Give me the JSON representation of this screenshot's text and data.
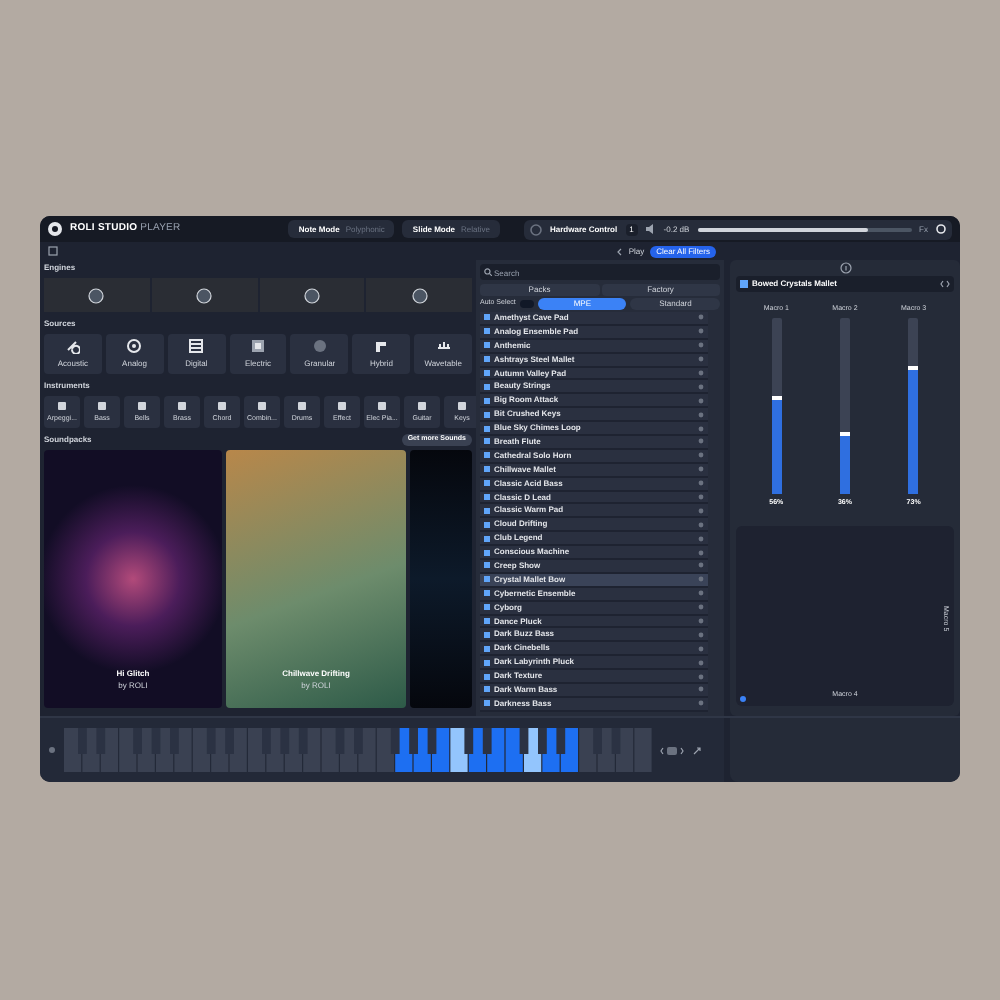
{
  "window": {
    "title_bold": "ROLI STUDIO",
    "title_light": "PLAYER"
  },
  "modes": [
    {
      "label": "Note Mode",
      "value": "Polyphonic"
    },
    {
      "label": "Slide Mode",
      "value": "Relative"
    }
  ],
  "hardware": {
    "label": "Hardware Control",
    "channel": "1",
    "volume": "-0.2 dB",
    "level": 0.8,
    "fx": "Fx"
  },
  "filters": {
    "play": "Play",
    "clear": "Clear All Filters"
  },
  "engines": {
    "title": "Engines"
  },
  "sources": {
    "title": "Sources",
    "items": [
      "Acoustic",
      "Analog",
      "Digital",
      "Electric",
      "Granular",
      "Hybrid",
      "Wavetable"
    ]
  },
  "instruments": {
    "title": "Instruments",
    "items": [
      "Arpeggi...",
      "Bass",
      "Bells",
      "Brass",
      "Chord",
      "Combin...",
      "Drums",
      "Effect",
      "Elec Pia...",
      "Guitar",
      "Keys"
    ]
  },
  "soundpacks": {
    "title": "Soundpacks",
    "more": "Get more Sounds",
    "cards": [
      {
        "name": "Hi Glitch",
        "by": "by ROLI",
        "kind": "neon"
      },
      {
        "name": "Chillwave Drifting",
        "by": "by ROLI",
        "kind": "pastel"
      },
      {
        "kind": "dark"
      }
    ]
  },
  "browser": {
    "search": {
      "placeholder": "Search"
    },
    "tabs": [
      {
        "label": "Packs",
        "selected": false
      },
      {
        "label": "Factory",
        "selected": false
      }
    ],
    "auto_select": {
      "label": "Auto Select",
      "on": false
    },
    "modes": [
      {
        "label": "MPE",
        "selected": true
      },
      {
        "label": "Standard",
        "selected": false
      }
    ],
    "presets": [
      {
        "name": "Amethyst Cave Pad",
        "selected": false
      },
      {
        "name": "Analog Ensemble Pad",
        "selected": false
      },
      {
        "name": "Anthemic",
        "selected": false
      },
      {
        "name": "Ashtrays Steel Mallet",
        "selected": false
      },
      {
        "name": "Autumn Valley Pad",
        "selected": false
      },
      {
        "name": "Beauty Strings",
        "selected": false
      },
      {
        "name": "Big Room Attack",
        "selected": false
      },
      {
        "name": "Bit Crushed Keys",
        "selected": false
      },
      {
        "name": "Blue Sky Chimes Loop",
        "selected": false
      },
      {
        "name": "Breath Flute",
        "selected": false
      },
      {
        "name": "Cathedral Solo Horn",
        "selected": false
      },
      {
        "name": "Chillwave Mallet",
        "selected": false
      },
      {
        "name": "Classic Acid Bass",
        "selected": false
      },
      {
        "name": "Classic D Lead",
        "selected": false
      },
      {
        "name": "Classic Warm Pad",
        "selected": false
      },
      {
        "name": "Cloud Drifting",
        "selected": false
      },
      {
        "name": "Club Legend",
        "selected": false
      },
      {
        "name": "Conscious Machine",
        "selected": false
      },
      {
        "name": "Creep Show",
        "selected": false
      },
      {
        "name": "Crystal Mallet Bow",
        "selected": true
      },
      {
        "name": "Cybernetic Ensemble",
        "selected": false
      },
      {
        "name": "Cyborg",
        "selected": false
      },
      {
        "name": "Dance Pluck",
        "selected": false
      },
      {
        "name": "Dark Buzz Bass",
        "selected": false
      },
      {
        "name": "Dark Cinebells",
        "selected": false
      },
      {
        "name": "Dark Labyrinth Pluck",
        "selected": false
      },
      {
        "name": "Dark Texture",
        "selected": false
      },
      {
        "name": "Dark Warm Bass",
        "selected": false
      },
      {
        "name": "Darkness Bass",
        "selected": false
      }
    ]
  },
  "macros": {
    "preset": "Bowed Crystals Mallet",
    "sliders": [
      {
        "label": "Macro 1",
        "level": 0.56,
        "reading": "56%"
      },
      {
        "label": "Macro 2",
        "level": 0.36,
        "reading": "36%"
      },
      {
        "label": "Macro 3",
        "level": 0.73,
        "reading": "73%"
      }
    ],
    "pad": {
      "x_label": "Macro 4",
      "y_label": "Macro 5"
    }
  }
}
